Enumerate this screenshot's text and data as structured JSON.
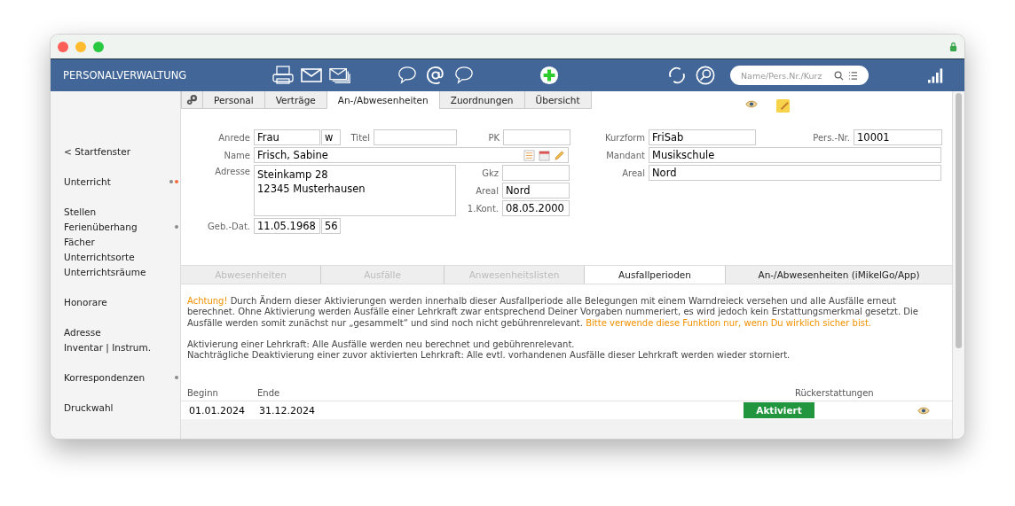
{
  "app_title": "PERSONALVERWALTUNG",
  "search": {
    "placeholder": "Name/Pers.Nr./Kurz"
  },
  "sidebar": {
    "groups": [
      [
        {
          "label": "< Startfenster"
        }
      ],
      [
        {
          "label": "Unterricht",
          "dots": [
            {
              "color": "#8a8a8a"
            },
            {
              "color": "#f26b3a"
            }
          ]
        }
      ],
      [
        {
          "label": "Stellen"
        },
        {
          "label": "Ferienüberhang",
          "dots": [
            {
              "color": "#8a8a8a"
            }
          ]
        },
        {
          "label": "Fächer"
        },
        {
          "label": "Unterrichtsorte"
        },
        {
          "label": "Unterrichtsräume"
        }
      ],
      [
        {
          "label": "Honorare"
        }
      ],
      [
        {
          "label": "Adresse"
        },
        {
          "label": "Inventar | Instrum."
        }
      ],
      [
        {
          "label": "Korrespondenzen",
          "dots": [
            {
              "color": "#8a8a8a"
            }
          ]
        }
      ],
      [
        {
          "label": "Druckwahl"
        }
      ]
    ]
  },
  "tabs": [
    {
      "label": "Personal",
      "selected": false
    },
    {
      "label": "Verträge",
      "selected": false
    },
    {
      "label": "An-/Abwesenheiten",
      "selected": true
    },
    {
      "label": "Zuordnungen",
      "selected": false
    },
    {
      "label": "Übersicht",
      "selected": false
    }
  ],
  "form": {
    "anrede": {
      "label": "Anrede",
      "value": "Frau",
      "suffix": "w"
    },
    "titel": {
      "label": "Titel"
    },
    "pk": {
      "label": "PK"
    },
    "name": {
      "label": "Name",
      "value": "Frisch, Sabine"
    },
    "adresse": {
      "label": "Adresse",
      "lines": [
        "Steinkamp 28",
        "12345 Musterhausen"
      ]
    },
    "gkz": {
      "label": "Gkz"
    },
    "areal_left": {
      "label": "Areal",
      "value": "Nord"
    },
    "kont": {
      "label": "1.Kont.",
      "value": "08.05.2000"
    },
    "geb": {
      "label": "Geb.-Dat.",
      "value": "11.05.1968",
      "suffix": "56"
    },
    "kurzform": {
      "label": "Kurzform",
      "value": "FriSab"
    },
    "persnr": {
      "label": "Pers.-Nr.",
      "value": "10001"
    },
    "mandant": {
      "label": "Mandant",
      "value": "Musikschule"
    },
    "areal_right": {
      "label": "Areal",
      "value": "Nord"
    }
  },
  "subtabs": [
    {
      "label": "Abwesenheiten",
      "selected": false,
      "disabled": true
    },
    {
      "label": "Ausfälle",
      "selected": false,
      "disabled": true
    },
    {
      "label": "Anwesenheitslisten",
      "selected": false,
      "disabled": true
    },
    {
      "label": "Ausfallperioden",
      "selected": true,
      "disabled": false
    },
    {
      "label": "An-/Abwesenheiten (iMikelGo/App)",
      "selected": false,
      "disabled": false
    }
  ],
  "notice": [
    [
      {
        "kind": "warning",
        "text": "Achtung!"
      },
      {
        "kind": "normal",
        "text": " Durch Ändern dieser Aktivierungen werden innerhalb dieser Ausfallperiode alle Belegungen mit einem Warndreieck versehen und alle Ausfälle erneut berechnet. Ohne Aktivierung werden Ausfälle einer Lehrkraft zwar entsprechend Deiner Vorgaben nummeriert, es wird jedoch kein Erstattungsmerkmal gesetzt. Die Ausfälle werden somit zunächst nur „gesammelt“ und sind noch nicht gebührenrelevant. "
      },
      {
        "kind": "warning",
        "text": "Bitte verwende diese Funktion nur, wenn Du wirklich sicher bist."
      }
    ],
    [
      {
        "kind": "normal",
        "text": "Aktivierung einer Lehrkraft: Alle Ausfälle werden neu berechnet und gebührenrelevant."
      }
    ],
    [
      {
        "kind": "normal",
        "text": "Nachträgliche Deaktivierung einer zuvor aktivierten Lehrkraft: Alle evtl. vorhandenen Ausfälle dieser Lehrkraft werden wieder storniert."
      }
    ]
  ],
  "table": {
    "columns": [
      "Beginn",
      "Ende",
      "Rückerstattungen"
    ],
    "rows": [
      {
        "beginn": "01.01.2024",
        "ende": "31.12.2024",
        "status": "Aktiviert",
        "active": true
      }
    ]
  }
}
